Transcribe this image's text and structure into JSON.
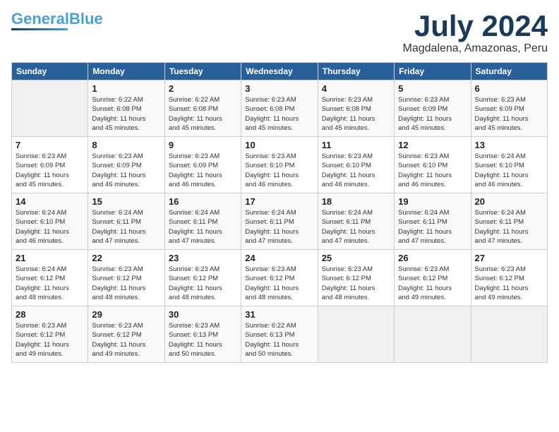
{
  "header": {
    "logo_general": "General",
    "logo_blue": "Blue",
    "month": "July 2024",
    "location": "Magdalena, Amazonas, Peru"
  },
  "days_of_week": [
    "Sunday",
    "Monday",
    "Tuesday",
    "Wednesday",
    "Thursday",
    "Friday",
    "Saturday"
  ],
  "weeks": [
    [
      {
        "day": "",
        "info": ""
      },
      {
        "day": "1",
        "info": "Sunrise: 6:22 AM\nSunset: 6:08 PM\nDaylight: 11 hours\nand 45 minutes."
      },
      {
        "day": "2",
        "info": "Sunrise: 6:22 AM\nSunset: 6:08 PM\nDaylight: 11 hours\nand 45 minutes."
      },
      {
        "day": "3",
        "info": "Sunrise: 6:23 AM\nSunset: 6:08 PM\nDaylight: 11 hours\nand 45 minutes."
      },
      {
        "day": "4",
        "info": "Sunrise: 6:23 AM\nSunset: 6:08 PM\nDaylight: 11 hours\nand 45 minutes."
      },
      {
        "day": "5",
        "info": "Sunrise: 6:23 AM\nSunset: 6:09 PM\nDaylight: 11 hours\nand 45 minutes."
      },
      {
        "day": "6",
        "info": "Sunrise: 6:23 AM\nSunset: 6:09 PM\nDaylight: 11 hours\nand 45 minutes."
      }
    ],
    [
      {
        "day": "7",
        "info": "Sunrise: 6:23 AM\nSunset: 6:09 PM\nDaylight: 11 hours\nand 45 minutes."
      },
      {
        "day": "8",
        "info": "Sunrise: 6:23 AM\nSunset: 6:09 PM\nDaylight: 11 hours\nand 46 minutes."
      },
      {
        "day": "9",
        "info": "Sunrise: 6:23 AM\nSunset: 6:09 PM\nDaylight: 11 hours\nand 46 minutes."
      },
      {
        "day": "10",
        "info": "Sunrise: 6:23 AM\nSunset: 6:10 PM\nDaylight: 11 hours\nand 46 minutes."
      },
      {
        "day": "11",
        "info": "Sunrise: 6:23 AM\nSunset: 6:10 PM\nDaylight: 11 hours\nand 46 minutes."
      },
      {
        "day": "12",
        "info": "Sunrise: 6:23 AM\nSunset: 6:10 PM\nDaylight: 11 hours\nand 46 minutes."
      },
      {
        "day": "13",
        "info": "Sunrise: 6:24 AM\nSunset: 6:10 PM\nDaylight: 11 hours\nand 46 minutes."
      }
    ],
    [
      {
        "day": "14",
        "info": "Sunrise: 6:24 AM\nSunset: 6:10 PM\nDaylight: 11 hours\nand 46 minutes."
      },
      {
        "day": "15",
        "info": "Sunrise: 6:24 AM\nSunset: 6:11 PM\nDaylight: 11 hours\nand 47 minutes."
      },
      {
        "day": "16",
        "info": "Sunrise: 6:24 AM\nSunset: 6:11 PM\nDaylight: 11 hours\nand 47 minutes."
      },
      {
        "day": "17",
        "info": "Sunrise: 6:24 AM\nSunset: 6:11 PM\nDaylight: 11 hours\nand 47 minutes."
      },
      {
        "day": "18",
        "info": "Sunrise: 6:24 AM\nSunset: 6:11 PM\nDaylight: 11 hours\nand 47 minutes."
      },
      {
        "day": "19",
        "info": "Sunrise: 6:24 AM\nSunset: 6:11 PM\nDaylight: 11 hours\nand 47 minutes."
      },
      {
        "day": "20",
        "info": "Sunrise: 6:24 AM\nSunset: 6:11 PM\nDaylight: 11 hours\nand 47 minutes."
      }
    ],
    [
      {
        "day": "21",
        "info": "Sunrise: 6:24 AM\nSunset: 6:12 PM\nDaylight: 11 hours\nand 48 minutes."
      },
      {
        "day": "22",
        "info": "Sunrise: 6:23 AM\nSunset: 6:12 PM\nDaylight: 11 hours\nand 48 minutes."
      },
      {
        "day": "23",
        "info": "Sunrise: 6:23 AM\nSunset: 6:12 PM\nDaylight: 11 hours\nand 48 minutes."
      },
      {
        "day": "24",
        "info": "Sunrise: 6:23 AM\nSunset: 6:12 PM\nDaylight: 11 hours\nand 48 minutes."
      },
      {
        "day": "25",
        "info": "Sunrise: 6:23 AM\nSunset: 6:12 PM\nDaylight: 11 hours\nand 48 minutes."
      },
      {
        "day": "26",
        "info": "Sunrise: 6:23 AM\nSunset: 6:12 PM\nDaylight: 11 hours\nand 49 minutes."
      },
      {
        "day": "27",
        "info": "Sunrise: 6:23 AM\nSunset: 6:12 PM\nDaylight: 11 hours\nand 49 minutes."
      }
    ],
    [
      {
        "day": "28",
        "info": "Sunrise: 6:23 AM\nSunset: 6:12 PM\nDaylight: 11 hours\nand 49 minutes."
      },
      {
        "day": "29",
        "info": "Sunrise: 6:23 AM\nSunset: 6:12 PM\nDaylight: 11 hours\nand 49 minutes."
      },
      {
        "day": "30",
        "info": "Sunrise: 6:23 AM\nSunset: 6:13 PM\nDaylight: 11 hours\nand 50 minutes."
      },
      {
        "day": "31",
        "info": "Sunrise: 6:22 AM\nSunset: 6:13 PM\nDaylight: 11 hours\nand 50 minutes."
      },
      {
        "day": "",
        "info": ""
      },
      {
        "day": "",
        "info": ""
      },
      {
        "day": "",
        "info": ""
      }
    ]
  ]
}
